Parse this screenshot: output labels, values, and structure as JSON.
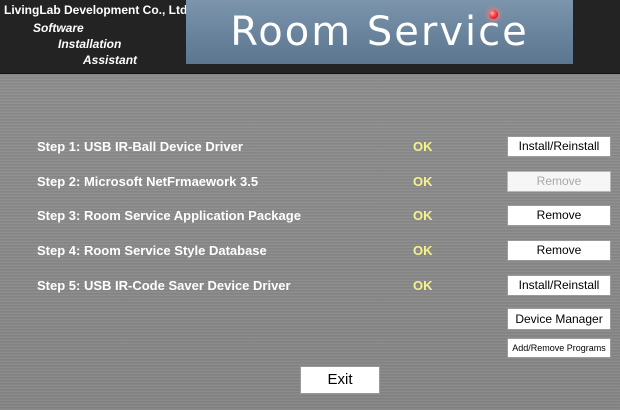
{
  "header": {
    "company": "LivingLab Development Co., Ltd.",
    "tagline": [
      "Software",
      "Installation",
      "Assistant"
    ],
    "logo_text": "Room Service"
  },
  "steps": [
    {
      "label": "Step 1:  USB IR-Ball Device Driver",
      "status": "OK",
      "button": "Install/Reinstall",
      "button_enabled": true
    },
    {
      "label": "Step 2:  Microsoft NetFrmaework 3.5",
      "status": "OK",
      "button": "Remove",
      "button_enabled": false
    },
    {
      "label": "Step 3:  Room Service Application Package",
      "status": "OK",
      "button": "Remove",
      "button_enabled": true
    },
    {
      "label": "Step 4:  Room Service Style Database",
      "status": "OK",
      "button": "Remove",
      "button_enabled": true
    },
    {
      "label": "Step 5:  USB IR-Code Saver Device Driver",
      "status": "OK",
      "button": "Install/Reinstall",
      "button_enabled": true
    }
  ],
  "extra_buttons": {
    "device_manager": "Device Manager",
    "add_remove": "Add/Remove Programs"
  },
  "exit_label": "Exit",
  "colors": {
    "header_bg": "#232323",
    "logo_bg": "#6f89a2",
    "status_ok": "#f4f38c",
    "body_bg": "#8d8d8d",
    "logo_dot": "#ff3b3b"
  }
}
